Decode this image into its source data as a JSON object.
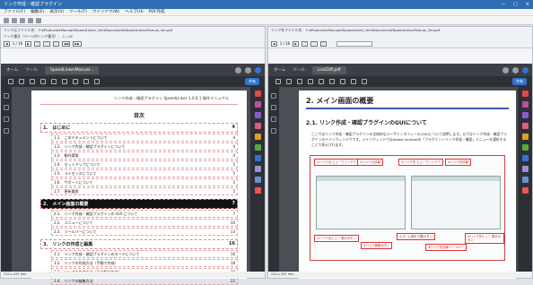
{
  "window": {
    "title": "リンク作成・確認ブラグイン",
    "controls": [
      "—",
      "□",
      "✕"
    ]
  },
  "menu": [
    "ファイル(F)",
    "編集(E)",
    "表示(V)",
    "ツール(T)",
    "ウインドウ(W)",
    "ヘルプ(H)",
    "PDF作成"
  ],
  "left_pane": {
    "path_line1": "リンク元ファイル名： F:¥Products¥Manual¥SpeedLinker_Ver¥Document¥SpeedLinkerManual_Ver.pdf",
    "path_line2": "リンク番号（ページ内リンク番号）： 1 / 16",
    "nav_page": "1 / 16",
    "nav_buttons": [
      "◀◀",
      "▶▶"
    ],
    "acrobat": {
      "tab_home": "ホーム",
      "tab_tools": "ツール",
      "doc_tab": "SpeedLinkerManual...",
      "share": "共有"
    },
    "page": {
      "header": "リンク作成・確認プラグイン SpeedLinker 1.0.6.1 操作マニュアル",
      "title": "目次",
      "toc": [
        {
          "level": 1,
          "label": "1.　はじめに",
          "page": "4",
          "active": false
        },
        {
          "level": 2,
          "label": "1.1.　このドキュメントについて",
          "page": "4"
        },
        {
          "level": 2,
          "label": "1.2.　リンク作成・確認プラグインについて",
          "page": "4"
        },
        {
          "level": 2,
          "label": "1.3.　動作環境",
          "page": "4"
        },
        {
          "level": 2,
          "label": "1.4.　セットアップについて",
          "page": "5"
        },
        {
          "level": 2,
          "label": "1.5.　ライセンスについて",
          "page": "5"
        },
        {
          "level": 2,
          "label": "1.6.　サポートについて",
          "page": "5"
        },
        {
          "level": 2,
          "label": "1.7.　更新履歴",
          "page": "5"
        },
        {
          "level": 1,
          "label": "2.　メイン画面の概要",
          "page": "7",
          "active": true
        },
        {
          "level": 2,
          "label": "2.1.　リンク作成・確認プラグインの GUI について",
          "page": "7"
        },
        {
          "level": 2,
          "label": "2.2.　メニューについて",
          "page": "10"
        },
        {
          "level": 2,
          "label": "2.3.　ツールバーについて",
          "page": "13"
        },
        {
          "level": 1,
          "label": "3.　リンクの作成と編集",
          "page": "16",
          "active": false
        },
        {
          "level": 2,
          "label": "3.1.　リンク作成・確認プラグインのモードについて",
          "page": "16"
        },
        {
          "level": 2,
          "label": "3.2.　リンクの作成方法（手動で作成）",
          "page": "18"
        },
        {
          "level": 2,
          "label": "3.3.　リンクの作成方法（半自動で作成）",
          "page": "19"
        },
        {
          "level": 2,
          "label": "3.4.　リンクの編集方法",
          "page": "22"
        }
      ]
    },
    "status": "210 x 297 mm"
  },
  "right_pane": {
    "path_line1": "リンク先ファイル名： F:¥Products¥Manual¥SpeedLinker_Ver¥Document¥SpeedLinkerManual_Ver.pdf",
    "nav_page": "1 / 16",
    "acrobat": {
      "tab_home": "ホーム",
      "tab_tools": "ツール",
      "doc_tab": "LinkDiff.pdf",
      "share": "共有"
    },
    "page": {
      "title": "2. メイン画面の概要",
      "subtitle": "2.1. リンク作成・確認プラグインのGUIについて",
      "para": "ここではリンク作成・確認プラグインの全体的なユーザインタフェース(GUI)について説明します。以下はリンク作成・確認プラグインのメインウィンドウです。メインウィンドウはAdobe Acrobatの「プラグイン＞リンク作成・確認」メニューを選択することで表示されます。",
      "callouts": [
        "①リンク元 ビューウィンドウ",
        "②リンク元情報",
        "③リンク先 ビューウィンドウ",
        "④リンク先情報",
        "⑤リンク元ビュー 表示ボタン",
        "⑥リンク移動ボタン",
        "⑦ズーム操作 切替ボタン",
        "⑧リンク先情報 ツールバー",
        "⑨リンク先ビュー 表示ボタン"
      ]
    },
    "status": "210 x 297 mm"
  }
}
